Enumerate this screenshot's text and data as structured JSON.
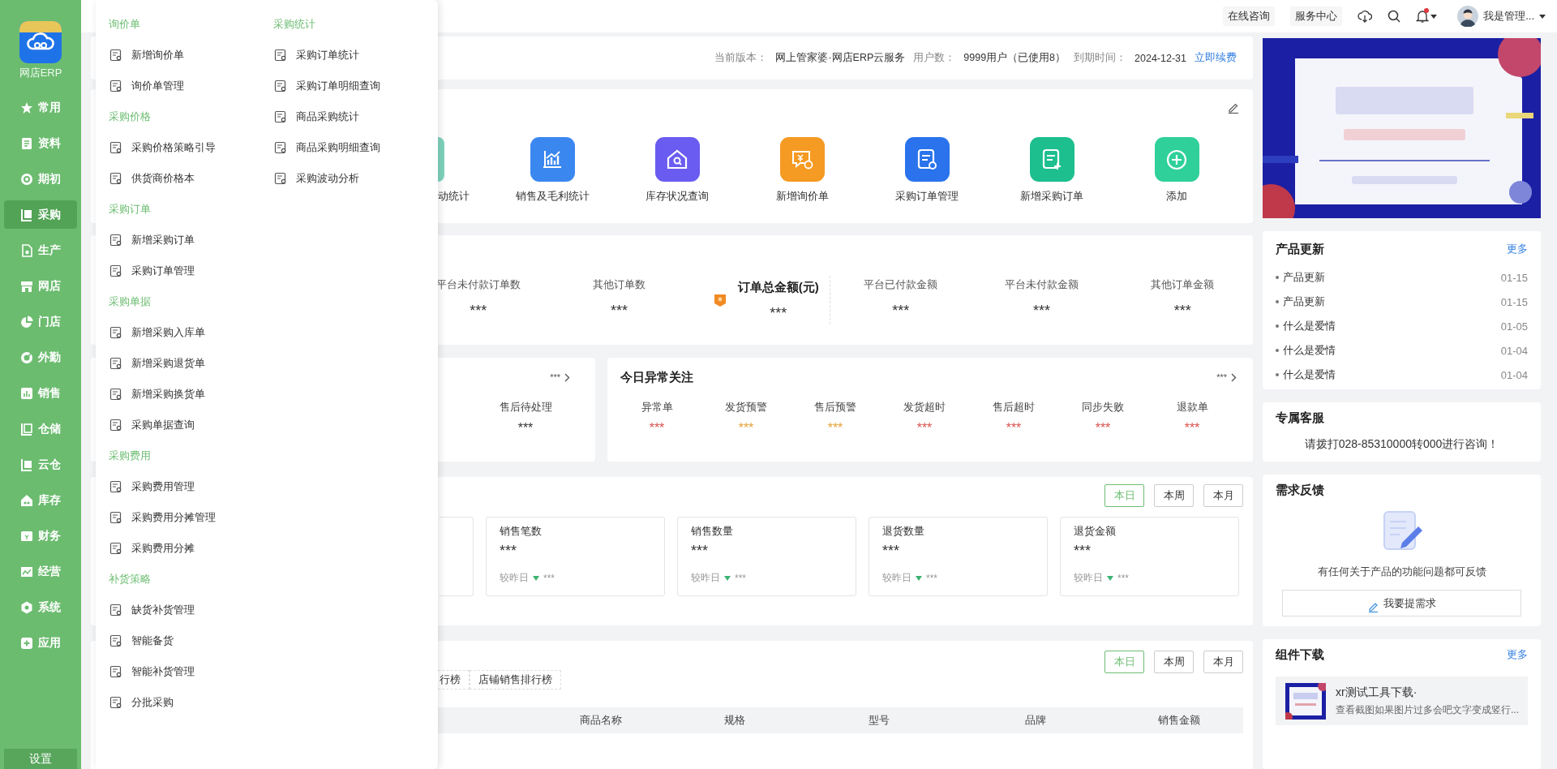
{
  "sidebar": {
    "app_name": "网店ERP",
    "items": [
      {
        "label": "常用",
        "selected": false
      },
      {
        "label": "资料",
        "selected": false
      },
      {
        "label": "期初",
        "selected": false
      },
      {
        "label": "采购",
        "selected": true
      },
      {
        "label": "生产",
        "selected": false
      },
      {
        "label": "网店",
        "selected": false
      },
      {
        "label": "门店",
        "selected": false
      },
      {
        "label": "外勤",
        "selected": false
      },
      {
        "label": "销售",
        "selected": false
      },
      {
        "label": "仓储",
        "selected": false
      },
      {
        "label": "云仓",
        "selected": false
      },
      {
        "label": "库存",
        "selected": false
      },
      {
        "label": "财务",
        "selected": false
      },
      {
        "label": "经营",
        "selected": false
      },
      {
        "label": "系统",
        "selected": false
      },
      {
        "label": "应用",
        "selected": false
      }
    ],
    "settings": "设置"
  },
  "flyout": {
    "columns": [
      [
        {
          "title": "询价单",
          "items": [
            "新增询价单",
            "询价单管理"
          ]
        },
        {
          "title": "采购价格",
          "items": [
            "采购价格策略引导",
            "供货商价格本"
          ]
        },
        {
          "title": "采购订单",
          "items": [
            "新增采购订单",
            "采购订单管理"
          ]
        },
        {
          "title": "采购单据",
          "items": [
            "新增采购入库单",
            "新增采购退货单",
            "新增采购换货单",
            "采购单据查询"
          ]
        },
        {
          "title": "采购费用",
          "items": [
            "采购费用管理",
            "采购费用分摊管理",
            "采购费用分摊"
          ]
        },
        {
          "title": "补货策略",
          "items": [
            "缺货补货管理",
            "智能备货",
            "智能补货管理",
            "分批采购"
          ]
        }
      ],
      [
        {
          "title": "采购统计",
          "items": [
            "采购订单统计",
            "采购订单明细查询",
            "商品采购统计",
            "商品采购明细查询",
            "采购波动分析"
          ]
        }
      ]
    ]
  },
  "topbar": {
    "links": [
      "在线咨询",
      "服务中心"
    ],
    "notification_dot": true,
    "user": "我是管理..."
  },
  "version_bar": {
    "fields": [
      {
        "label": "当前版本：",
        "value": "网上管家婆·网店ERP云服务"
      },
      {
        "label": "用户数：",
        "value": "9999用户（已使用8）"
      },
      {
        "label": "到期时间：",
        "value": "2024-12-31"
      }
    ],
    "renew_link": "立即续费"
  },
  "shortcuts": {
    "items": [
      {
        "kind": "partial",
        "label": "动统计",
        "color": "#7fd3bd"
      },
      {
        "kind": "chart",
        "label": "销售及毛利统计",
        "color": "#3b87f0"
      },
      {
        "kind": "house",
        "label": "库存状况查询",
        "color": "#6a5cf0"
      },
      {
        "kind": "chat",
        "label": "新增询价单",
        "color": "#f59a23"
      },
      {
        "kind": "document",
        "label": "采购订单管理",
        "color": "#2a73ec"
      },
      {
        "kind": "document-plus",
        "label": "新增采购订单",
        "color": "#1dbf8f"
      },
      {
        "kind": "plus",
        "label": "添加",
        "color": "#2fd09a"
      }
    ]
  },
  "order_stats": {
    "items": [
      {
        "kind": "plain",
        "label": "平台未付款订单数",
        "value": "***"
      },
      {
        "kind": "plain",
        "label": "其他订单数",
        "value": "***"
      },
      {
        "kind": "total",
        "label": "订单总金额(元)",
        "value": "***"
      },
      {
        "kind": "plain",
        "label": "平台已付款金额",
        "value": "***"
      },
      {
        "kind": "plain",
        "label": "平台未付款金额",
        "value": "***"
      },
      {
        "kind": "plain",
        "label": "其他订单金额",
        "value": "***"
      }
    ]
  },
  "aftersale": {
    "more": "***",
    "items": [
      {
        "label": "售后待处理",
        "value": "***"
      }
    ]
  },
  "anomalies": {
    "title": "今日异常关注",
    "more": "***",
    "items": [
      {
        "label": "异常单",
        "value": "***",
        "color": "#d9534f"
      },
      {
        "label": "发货预警",
        "value": "***",
        "color": "#e6a23c"
      },
      {
        "label": "售后预警",
        "value": "***",
        "color": "#e6a23c"
      },
      {
        "label": "发货超时",
        "value": "***",
        "color": "#d9534f"
      },
      {
        "label": "售后超时",
        "value": "***",
        "color": "#d9534f"
      },
      {
        "label": "同步失败",
        "value": "***",
        "color": "#d9534f"
      },
      {
        "label": "退款单",
        "value": "***",
        "color": "#d9534f"
      }
    ]
  },
  "sales": {
    "periods": [
      {
        "label": "本日",
        "selected": true
      },
      {
        "label": "本周",
        "selected": false
      },
      {
        "label": "本月",
        "selected": false
      }
    ],
    "stats": [
      {
        "label": "销售笔数",
        "value": "***",
        "compare": "较昨日",
        "change": "***"
      },
      {
        "label": "销售数量",
        "value": "***",
        "compare": "较昨日",
        "change": "***"
      },
      {
        "label": "退货数量",
        "value": "***",
        "compare": "较昨日",
        "change": "***"
      },
      {
        "label": "退货金额",
        "value": "***",
        "compare": "较昨日",
        "change": "***"
      }
    ]
  },
  "ranking": {
    "periods": [
      {
        "label": "本日",
        "selected": true
      },
      {
        "label": "本周",
        "selected": false
      },
      {
        "label": "本月",
        "selected": false
      }
    ],
    "tabs": [
      {
        "label": "行榜",
        "selected": false
      },
      {
        "label": "店铺销售排行榜",
        "selected": false
      }
    ],
    "columns": [
      "商品名称",
      "规格",
      "型号",
      "品牌",
      "销售金额"
    ]
  },
  "updates": {
    "title": "产品更新",
    "more": "更多",
    "items": [
      {
        "title": "产品更新",
        "date": "01-15"
      },
      {
        "title": "产品更新",
        "date": "01-15"
      },
      {
        "title": "什么是爱情",
        "date": "01-05"
      },
      {
        "title": "什么是爱情",
        "date": "01-04"
      },
      {
        "title": "什么是爱情",
        "date": "01-04"
      }
    ]
  },
  "service": {
    "title": "专属客服",
    "text": "请拨打028-85310000转000进行咨询！"
  },
  "feedback": {
    "title": "需求反馈",
    "text": "有任何关于产品的功能问题都可反馈",
    "button": "我要提需求"
  },
  "downloads": {
    "title": "组件下载",
    "more": "更多",
    "items": [
      {
        "title": "xr测试工具下载·",
        "description": "查看截图如果图片过多会吧文字变成竖行..."
      }
    ]
  }
}
